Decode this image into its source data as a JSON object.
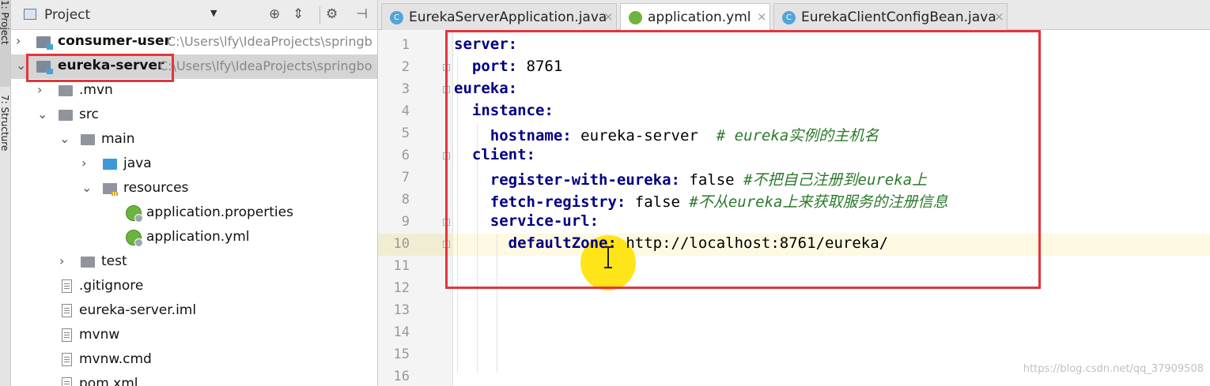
{
  "tool_strip": {
    "project_tab": "1: Project",
    "structure_tab": "7: Structure"
  },
  "project_panel": {
    "title": "Project",
    "header_icons": [
      "target-icon",
      "collapse-icon",
      "gear-icon",
      "hide-icon"
    ],
    "tree": [
      {
        "label": "consumer-user",
        "path": "C:\\Users\\lfy\\IdeaProjects\\springb",
        "icon": "module-icon",
        "expanded": false,
        "bold": true
      },
      {
        "label": "eureka-server",
        "path": "C:\\Users\\lfy\\IdeaProjects\\springbo",
        "icon": "module-icon",
        "expanded": true,
        "bold": true,
        "selected": true
      },
      {
        "label": ".mvn",
        "icon": "folder-icon",
        "expanded": false
      },
      {
        "label": "src",
        "icon": "folder-icon",
        "expanded": true
      },
      {
        "label": "main",
        "icon": "folder-icon",
        "expanded": true
      },
      {
        "label": "java",
        "icon": "source-folder-icon",
        "expanded": false
      },
      {
        "label": "resources",
        "icon": "resources-folder-icon",
        "expanded": true
      },
      {
        "label": "application.properties",
        "icon": "spring-config-icon"
      },
      {
        "label": "application.yml",
        "icon": "spring-config-icon"
      },
      {
        "label": "test",
        "icon": "folder-icon",
        "expanded": false
      },
      {
        "label": ".gitignore",
        "icon": "file-icon"
      },
      {
        "label": "eureka-server.iml",
        "icon": "file-icon"
      },
      {
        "label": "mvnw",
        "icon": "file-icon"
      },
      {
        "label": "mvnw.cmd",
        "icon": "file-icon"
      },
      {
        "label": "pom.xml",
        "icon": "file-icon"
      }
    ]
  },
  "editor": {
    "tabs": [
      {
        "label": "EurekaServerApplication.java",
        "icon": "java-class-icon",
        "active": false
      },
      {
        "label": "application.yml",
        "icon": "spring-config-icon",
        "active": true
      },
      {
        "label": "EurekaClientConfigBean.java",
        "icon": "java-class-icon",
        "active": false
      }
    ],
    "line_numbers": [
      "1",
      "2",
      "3",
      "4",
      "5",
      "6",
      "7",
      "8",
      "9",
      "10",
      "11",
      "12",
      "13",
      "14",
      "15",
      "16"
    ],
    "current_line": "10",
    "lines": [
      {
        "key": "server:",
        "value": "",
        "comment": ""
      },
      {
        "key": "  port:",
        "value": " 8761",
        "comment": ""
      },
      {
        "key": "eureka:",
        "value": "",
        "comment": ""
      },
      {
        "key": "  instance:",
        "value": "",
        "comment": ""
      },
      {
        "key": "    hostname:",
        "value": " eureka-server  ",
        "comment": "# eureka实例的主机名"
      },
      {
        "key": "  client:",
        "value": "",
        "comment": ""
      },
      {
        "key": "    register-with-eureka:",
        "value": " false ",
        "comment": "#不把自己注册到eureka上"
      },
      {
        "key": "    fetch-registry:",
        "value": " false ",
        "comment": "#不从eureka上来获取服务的注册信息"
      },
      {
        "key": "    service-url:",
        "value": "",
        "comment": ""
      },
      {
        "key": "      defaultZone:",
        "value": " http://localhost:8761/eureka/",
        "comment": ""
      }
    ]
  },
  "watermark": "https://blog.csdn.net/qq_37909508",
  "colors": {
    "highlight_border": "#e3353c",
    "yaml_key": "#000080",
    "comment": "#2a7a2a",
    "cursor_spot": "#ffe100"
  }
}
